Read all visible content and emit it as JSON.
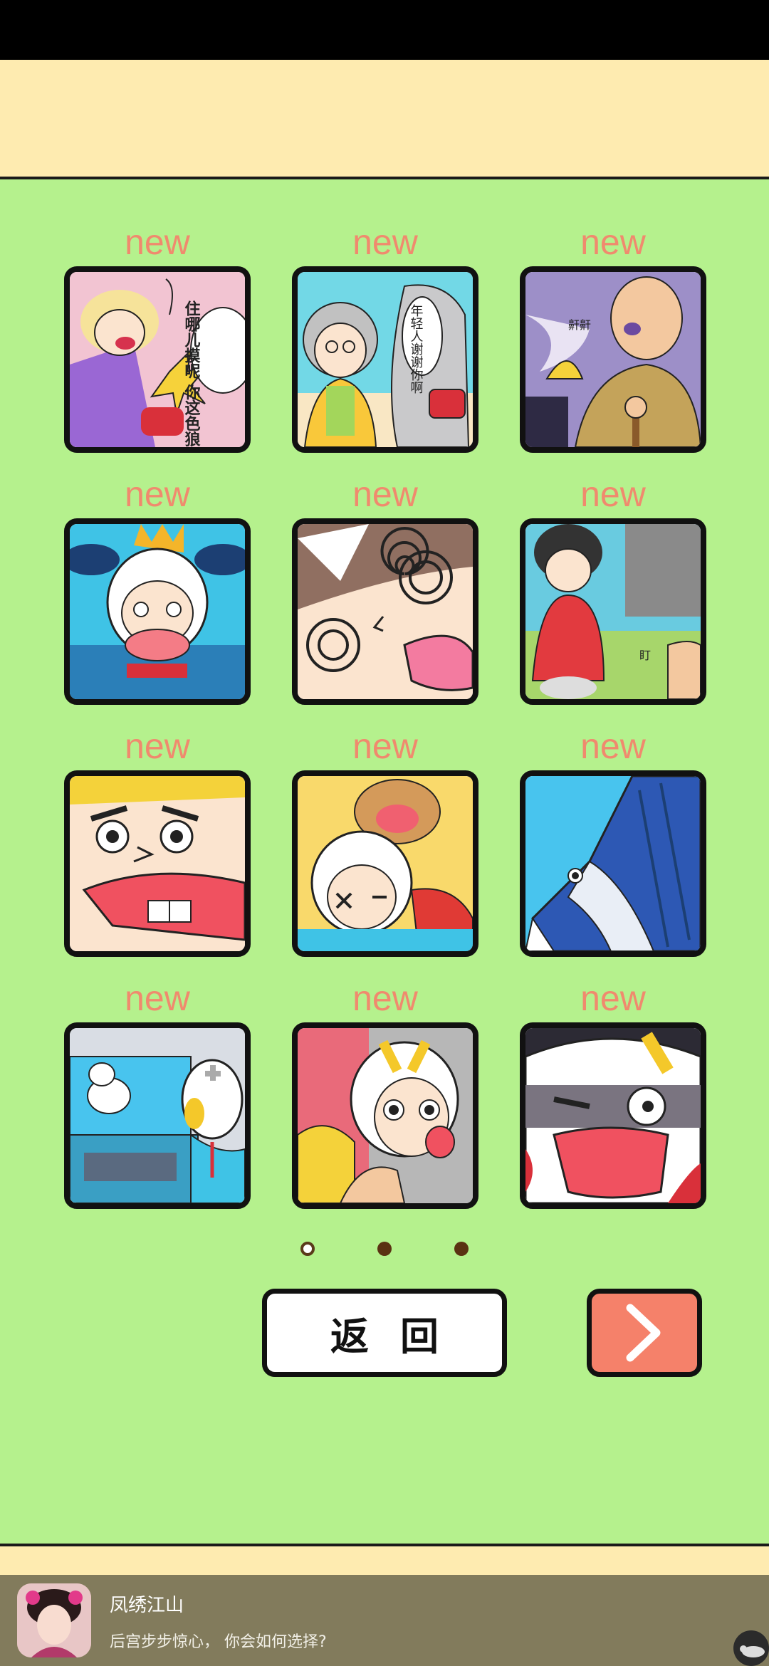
{
  "levels": [
    {
      "badge": "new",
      "scene": "dancer-slap"
    },
    {
      "badge": "new",
      "scene": "grandma-bus"
    },
    {
      "badge": "new",
      "scene": "old-man-cane"
    },
    {
      "badge": "new",
      "scene": "police-rider"
    },
    {
      "badge": "new",
      "scene": "dizzy-face"
    },
    {
      "badge": "new",
      "scene": "kimono-lady"
    },
    {
      "badge": "new",
      "scene": "angry-face-tongue"
    },
    {
      "badge": "new",
      "scene": "monkey-rider"
    },
    {
      "badge": "new",
      "scene": "swordfish"
    },
    {
      "badge": "new",
      "scene": "cat-car"
    },
    {
      "badge": "new",
      "scene": "crowd-rider"
    },
    {
      "badge": "new",
      "scene": "shocked-rider"
    }
  ],
  "bubbles": {
    "level1": "住哪儿摸呢 你这色狼!",
    "level2": "年轻人谢谢你啊",
    "level3": "鼾鼾",
    "level6": "盯"
  },
  "pager": {
    "pages": 3,
    "current": 1
  },
  "buttons": {
    "back_label": "返回",
    "next_icon": "chevron-right-icon"
  },
  "ad": {
    "title": "凤绣江山",
    "description": "后宫步步惊心， 你会如何选择?"
  },
  "colors": {
    "background": "#b5f18d",
    "banner": "#feebb0",
    "badge": "#f08a6e",
    "next_button": "#f5816a",
    "ad_bar": "#827b5c"
  }
}
